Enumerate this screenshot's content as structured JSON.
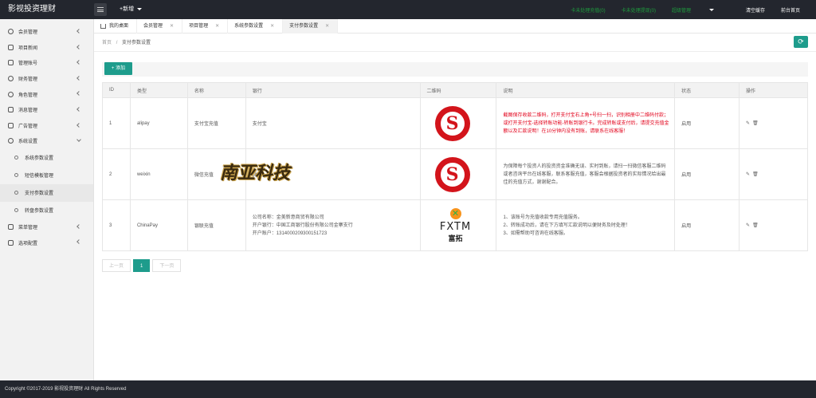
{
  "brand": "影视投资理财",
  "topbar": {
    "new_label": "+新增",
    "links": [
      {
        "label": "卡未处理充值(0)",
        "color": "green"
      },
      {
        "label": "卡未处理提现(0)",
        "color": "green"
      },
      {
        "label": "超级管理",
        "color": "green"
      },
      {
        "label": "清空缓存",
        "color": "white"
      },
      {
        "label": "前台首页",
        "color": "white"
      }
    ]
  },
  "sidebar": {
    "items": [
      {
        "label": "会员管理"
      },
      {
        "label": "项目新闻"
      },
      {
        "label": "管理账号"
      },
      {
        "label": "财务管理"
      },
      {
        "label": "角色管理"
      },
      {
        "label": "消息管理"
      },
      {
        "label": "广告管理"
      },
      {
        "label": "系统设置"
      }
    ],
    "subitems": [
      {
        "label": "系统参数设置"
      },
      {
        "label": "短信模板管理"
      },
      {
        "label": "支付参数设置"
      },
      {
        "label": "转盘参数设置"
      }
    ],
    "items_after": [
      {
        "label": "菜单管理"
      },
      {
        "label": "选项配置"
      }
    ]
  },
  "tabs": [
    {
      "label": "我的桌面",
      "closable": false
    },
    {
      "label": "会员管理",
      "closable": true
    },
    {
      "label": "项目管理",
      "closable": true
    },
    {
      "label": "系统参数设置",
      "closable": true
    },
    {
      "label": "支付参数设置",
      "closable": true,
      "active": true
    }
  ],
  "breadcrumb": {
    "home": "首页",
    "sep": "/",
    "current": "支付参数设置"
  },
  "add_button": "+ 添加",
  "table": {
    "headers": [
      "ID",
      "类型",
      "名称",
      "银行",
      "二维码",
      "说明",
      "状态",
      "操作"
    ],
    "rows": [
      {
        "id": "1",
        "type": "alipay",
        "name": "支付宝充值",
        "bank": "支付宝",
        "desc": "截图保存收款二维码，打开支付宝右上角+号扫一扫，识别相册中二维码付款；或打开支付宝-选择转账功能-转账到银行卡。完成转账或支付后，请提交充值金额以及汇款说明！在10分钟内没有到账，请联系在线客服！",
        "status": "启用"
      },
      {
        "id": "2",
        "type": "weixin",
        "name": "微信充值",
        "bank": "微信",
        "desc": "为保障每个投资人的投资资金准确无误、实时到账，请扫一扫微信客服二维码或者咨询平台在线客服，联系客服充值，客服会根据投资者的实际情况给出最佳的充值方式，谢谢配合。",
        "status": "启用"
      },
      {
        "id": "3",
        "type": "ChinaPay",
        "name": "银联充值",
        "bank_lines": [
          "公司名称：金美新意商贸有限公司",
          "开户银行：中国工商银行股份有限公司金寨支行",
          "开户账户：1314000209300151723"
        ],
        "desc_lines": [
          "1、该账号为充值收款专用充值服务。",
          "2、转账成功后，请在下方填写汇款说明以便财务及时处理！",
          "3、如需帮助可咨询在线客服。"
        ],
        "status": "启用"
      }
    ]
  },
  "watermark_text": "南亚科技",
  "fxtm": {
    "brand": "FXTM",
    "cn": "富拓"
  },
  "pager": {
    "prev": "上一页",
    "current": "1",
    "next": "下一页"
  },
  "footer": "Copyright ©2017-2019 影视投资理财 All Rights Reserved"
}
